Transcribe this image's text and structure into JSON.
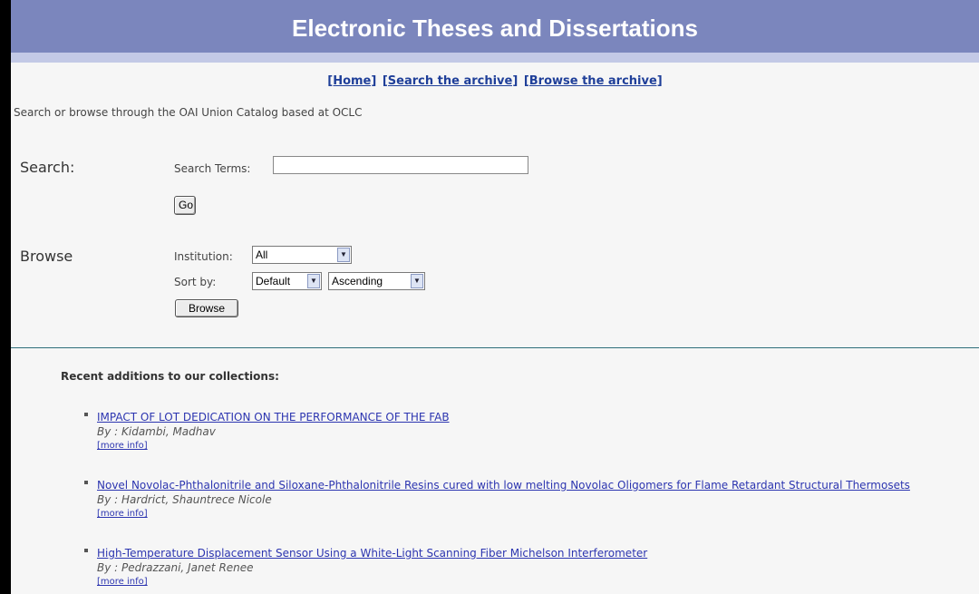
{
  "banner": {
    "title": "Electronic Theses and Dissertations"
  },
  "topnav": {
    "home": "[Home]",
    "search": "[Search the archive]",
    "browse": "[Browse the archive]"
  },
  "intro": "Search or browse through the OAI Union Catalog based at OCLC",
  "search": {
    "section_label": "Search:",
    "terms_label": "Search Terms:",
    "terms_value": "",
    "go_label": "Go"
  },
  "browse": {
    "section_label": "Browse",
    "institution_label": "Institution:",
    "institution_value": "All",
    "sortby_label": "Sort by:",
    "sort_value": "Default",
    "order_value": "Ascending",
    "button_label": "Browse"
  },
  "recent": {
    "heading": "Recent additions to our collections:",
    "items": [
      {
        "title": "IMPACT OF LOT DEDICATION ON THE PERFORMANCE OF THE FAB",
        "author": "By : Kidambi, Madhav",
        "more": "[more info]"
      },
      {
        "title": "Novel Novolac-Phthalonitrile and Siloxane-Phthalonitrile Resins cured with low melting Novolac Oligomers for Flame Retardant Structural Thermosets",
        "author": "By : Hardrict, Shauntrece Nicole",
        "more": "[more info]"
      },
      {
        "title": "High-Temperature Displacement Sensor Using a White-Light Scanning Fiber Michelson Interferometer",
        "author": "By : Pedrazzani, Janet Renee",
        "more": "[more info]"
      }
    ]
  },
  "colors": {
    "banner": "#7b86bd",
    "banner_rule": "#c3c9e6",
    "link": "#2c35b0",
    "divider": "#2f6f7a"
  }
}
